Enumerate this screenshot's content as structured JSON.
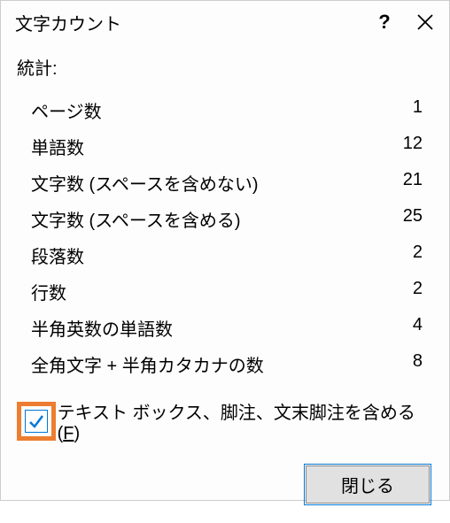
{
  "dialog": {
    "title": "文字カウント",
    "help_symbol": "?",
    "stats_heading": "統計:",
    "rows": [
      {
        "label": "ページ数",
        "value": "1"
      },
      {
        "label": "単語数",
        "value": "12"
      },
      {
        "label": "文字数 (スペースを含めない)",
        "value": "21"
      },
      {
        "label": "文字数 (スペースを含める)",
        "value": "25"
      },
      {
        "label": "段落数",
        "value": "2"
      },
      {
        "label": "行数",
        "value": "2"
      },
      {
        "label": "半角英数の単語数",
        "value": "4"
      },
      {
        "label": "全角文字 + 半角カタカナの数",
        "value": "8"
      }
    ],
    "checkbox": {
      "checked": true,
      "label_pre": "テキスト ボックス、脚注、文末脚注を含める(",
      "accel": "F",
      "label_post": ")"
    },
    "close_button": "閉じる"
  }
}
